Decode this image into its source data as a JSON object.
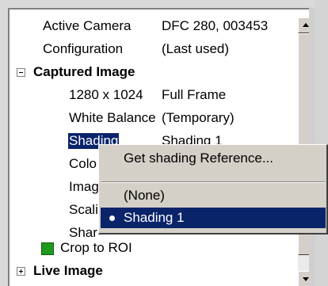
{
  "property_grid": {
    "rows": [
      {
        "label": "Active Camera",
        "value": "DFC 280, 003453"
      },
      {
        "label": "Configuration",
        "value": "(Last used)"
      },
      {
        "label": "Captured Image",
        "type": "group",
        "expanded": true
      },
      {
        "label": "1280 x 1024",
        "value": "Full Frame"
      },
      {
        "label": "White Balance",
        "value": "(Temporary)"
      },
      {
        "label": "Shading",
        "value": "Shading 1",
        "selected": true
      },
      {
        "label": "Colo"
      },
      {
        "label": "Imag"
      },
      {
        "label": "Scali"
      },
      {
        "label": "Shar"
      },
      {
        "label": "Crop to ROI",
        "checked": true,
        "color": "#1f9a1f"
      },
      {
        "label": "Live Image",
        "type": "group",
        "expanded": false
      }
    ]
  },
  "context_menu": {
    "items": [
      {
        "label": "Get shading Reference..."
      },
      {
        "label": "(None)"
      },
      {
        "label": "Shading 1",
        "active": true
      }
    ]
  },
  "colors": {
    "selection": "#0a246a",
    "menu_bg": "#d4d0c8",
    "checkbox_green": "#1f9a1f"
  },
  "icons": {
    "collapse": "minus-box-icon",
    "expand": "plus-box-icon",
    "scroll_up": "triangle-up-icon",
    "scroll_down": "triangle-down-icon",
    "menu_selected": "bullet-icon"
  }
}
